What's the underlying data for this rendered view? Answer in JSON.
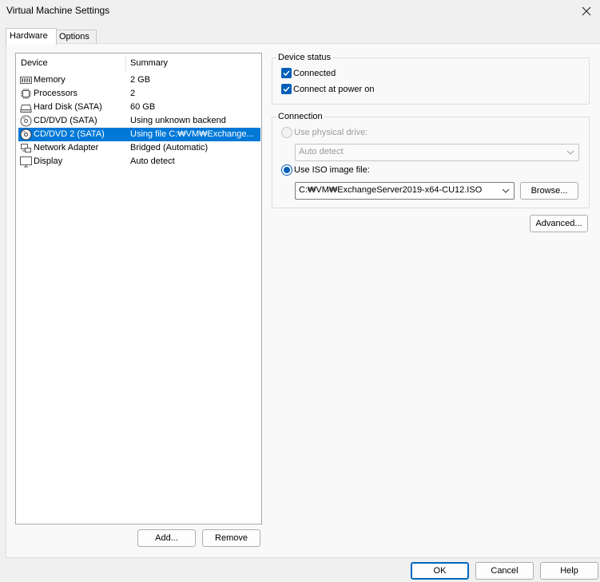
{
  "window": {
    "title": "Virtual Machine Settings"
  },
  "tabs": [
    {
      "label": "Hardware",
      "active": true
    },
    {
      "label": "Options",
      "active": false
    }
  ],
  "device_list": {
    "headers": {
      "device": "Device",
      "summary": "Summary"
    },
    "rows": [
      {
        "name": "Memory",
        "summary": "2 GB",
        "icon": "memory-icon"
      },
      {
        "name": "Processors",
        "summary": "2",
        "icon": "processor-icon"
      },
      {
        "name": "Hard Disk (SATA)",
        "summary": "60 GB",
        "icon": "hard-disk-icon"
      },
      {
        "name": "CD/DVD (SATA)",
        "summary": "Using unknown backend",
        "icon": "cd-dvd-icon"
      },
      {
        "name": "CD/DVD 2 (SATA)",
        "summary": "Using file C:₩VM₩Exchange...",
        "icon": "cd-dvd-icon",
        "selected": true
      },
      {
        "name": "Network Adapter",
        "summary": "Bridged (Automatic)",
        "icon": "network-adapter-icon"
      },
      {
        "name": "Display",
        "summary": "Auto detect",
        "icon": "display-icon"
      }
    ]
  },
  "list_buttons": {
    "add": "Add...",
    "remove": "Remove"
  },
  "device_status": {
    "legend": "Device status",
    "connected": {
      "label": "Connected",
      "checked": true
    },
    "connect_power_on": {
      "label": "Connect at power on",
      "checked": true
    }
  },
  "connection": {
    "legend": "Connection",
    "physical": {
      "label": "Use physical drive:",
      "selected": false,
      "enabled": false
    },
    "physical_value": "Auto detect",
    "iso": {
      "label": "Use ISO image file:",
      "selected": true
    },
    "iso_value": "C:₩VM₩ExchangeServer2019-x64-CU12.ISO",
    "browse": "Browse..."
  },
  "advanced": "Advanced...",
  "footer": {
    "ok": "OK",
    "cancel": "Cancel",
    "help": "Help"
  },
  "colors": {
    "accent": "#005fb8",
    "selection": "#0078d7"
  }
}
